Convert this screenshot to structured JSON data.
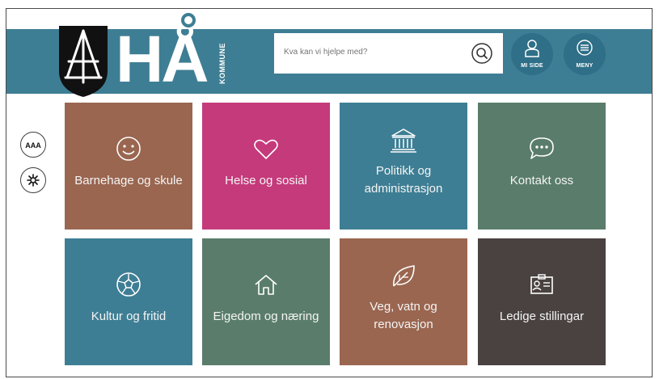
{
  "header": {
    "brand": "HÅ",
    "brand_sub": "KOMMUNE",
    "search_placeholder": "Kva kan vi hjelpe med?",
    "my_page_label": "MI SIDE",
    "menu_label": "MENY"
  },
  "colors": {
    "header": "#3e7e94",
    "brown": "#9a6650",
    "pink": "#c53a7b",
    "teal": "#3e7e94",
    "green": "#5a7d6b",
    "dark": "#494240"
  },
  "tiles": [
    {
      "label": "Barnehage og skule",
      "icon": "smiley-icon"
    },
    {
      "label": "Helse og sosial",
      "icon": "heart-icon"
    },
    {
      "label": "Politikk og administrasjon",
      "label_line1": "Politikk og",
      "label_line2": "administrasjon",
      "icon": "town-hall-icon"
    },
    {
      "label": "Kontakt oss",
      "icon": "chat-bubble-icon"
    },
    {
      "label": "Kultur og fritid",
      "icon": "football-icon"
    },
    {
      "label": "Eigedom og næring",
      "icon": "house-icon"
    },
    {
      "label": "Veg, vatn og renovasjon",
      "label_line1": "Veg, vatn og",
      "label_line2": "renovasjon",
      "icon": "leaf-icon"
    },
    {
      "label": "Ledige stillingar",
      "icon": "id-card-icon"
    }
  ],
  "side_tools": [
    {
      "icon": "font-size-icon",
      "text": "AAA"
    },
    {
      "icon": "contrast-icon"
    }
  ]
}
